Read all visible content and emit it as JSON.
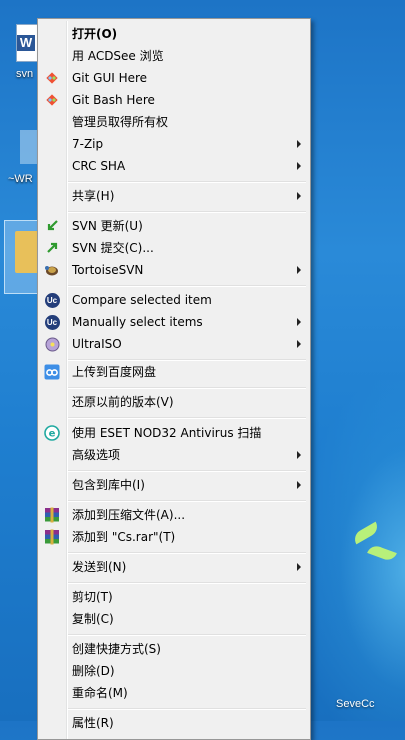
{
  "desktop": {
    "icons": [
      {
        "label": "svn"
      },
      {
        "label": "~WR"
      }
    ],
    "watermark": "SeveCc"
  },
  "menu": {
    "items": [
      {
        "label": "打开(O)",
        "icon": "none"
      },
      {
        "label": "用 ACDSee 浏览",
        "icon": "none"
      },
      {
        "label": "Git GUI Here",
        "icon": "git-icon"
      },
      {
        "label": "Git Bash Here",
        "icon": "git-icon"
      },
      {
        "label": "管理员取得所有权",
        "icon": "none"
      },
      {
        "label": "7-Zip",
        "icon": "none"
      },
      {
        "label": "CRC SHA",
        "icon": "none"
      },
      {
        "label": "共享(H)",
        "icon": "none"
      },
      {
        "label": "SVN 更新(U)",
        "icon": "svn-update-icon"
      },
      {
        "label": "SVN 提交(C)...",
        "icon": "svn-commit-icon"
      },
      {
        "label": "TortoiseSVN",
        "icon": "tortoise-icon"
      },
      {
        "label": "Compare selected item",
        "icon": "uc-icon"
      },
      {
        "label": "Manually select items",
        "icon": "uc-icon"
      },
      {
        "label": "UltraISO",
        "icon": "ultraiso-icon"
      },
      {
        "label": "上传到百度网盘",
        "icon": "baidu-cloud-icon"
      },
      {
        "label": "还原以前的版本(V)",
        "icon": "none"
      },
      {
        "label": "使用 ESET NOD32 Antivirus 扫描",
        "icon": "eset-icon"
      },
      {
        "label": "高级选项",
        "icon": "none"
      },
      {
        "label": "包含到库中(I)",
        "icon": "none"
      },
      {
        "label": "添加到压缩文件(A)...",
        "icon": "winrar-icon"
      },
      {
        "label": "添加到 \"Cs.rar\"(T)",
        "icon": "winrar-icon"
      },
      {
        "label": "发送到(N)",
        "icon": "none"
      },
      {
        "label": "剪切(T)",
        "icon": "none"
      },
      {
        "label": "复制(C)",
        "icon": "none"
      },
      {
        "label": "创建快捷方式(S)",
        "icon": "none"
      },
      {
        "label": "删除(D)",
        "icon": "none"
      },
      {
        "label": "重命名(M)",
        "icon": "none"
      },
      {
        "label": "属性(R)",
        "icon": "none"
      }
    ],
    "colors": {
      "background": "#f0f0f0",
      "border": "#979797",
      "text": "#000000"
    }
  }
}
